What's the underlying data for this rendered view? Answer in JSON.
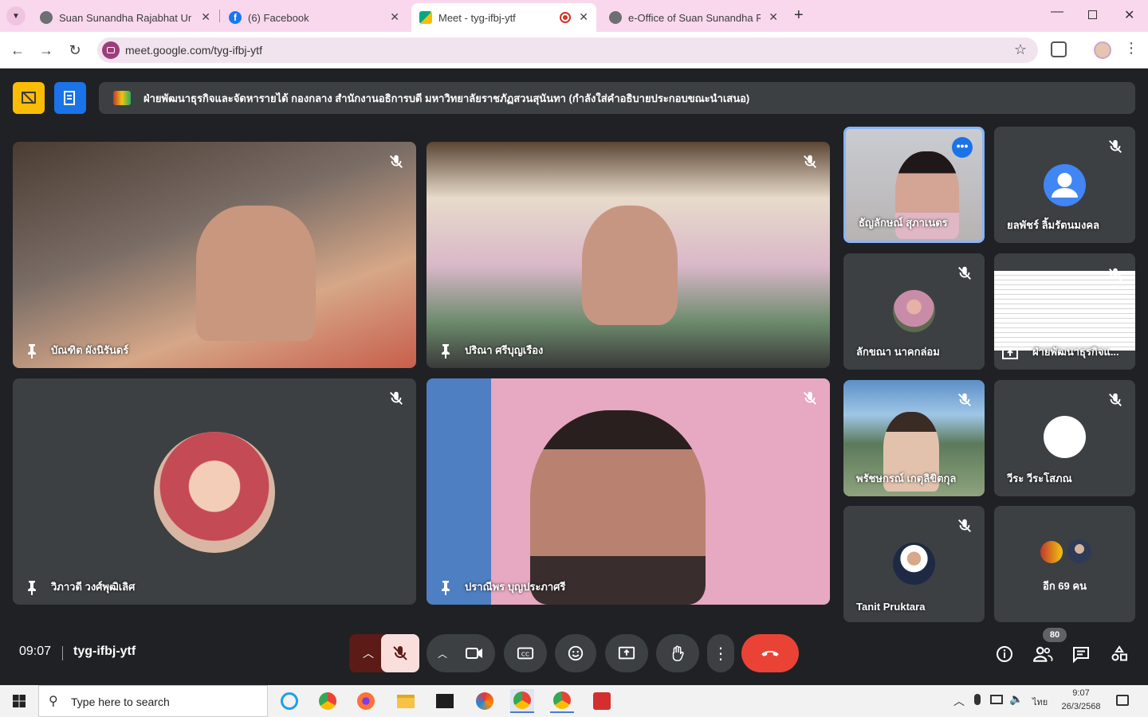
{
  "tabs": [
    {
      "label": "Suan Sunandha Rajabhat Unive",
      "fav": "#6d6f72"
    },
    {
      "label": "(6) Facebook",
      "fav": "#1877f2"
    },
    {
      "label": "Meet - tyg-ifbj-ytf",
      "fav": "#00a884"
    },
    {
      "label": "e-Office of Suan Sunandha Raja",
      "fav": "#6d6f72"
    }
  ],
  "url": "meet.google.com/tyg-ifbj-ytf",
  "caption": "ฝ่ายพัฒนาธุรกิจและจัดหารายได้ กองกลาง สำนักงานอธิการบดี มหาวิทยาลัยราชภัฏสวนสุนันทา (กำลังใส่คำอธิบายประกอบขณะนำเสนอ)",
  "participants": {
    "p1": "บัณฑิต ผังนิรันดร์",
    "p2": "ปริณา ศรีบุญเรือง",
    "p3": "วิภาวดี วงศ์พุฒิเลิศ",
    "p4": "ปราณีพร บุญประภาศรี",
    "s1": "ธัญลักษณ์ สุภาเนตร",
    "s2": "ยลพัชร์ ลิ้มรัตนมงคล",
    "s3": "ลักขณา นาคกล่อม",
    "s4": "ฝ่ายพัฒนาธุรกิจแ...",
    "s5": "พรัชษกรณ์ เกตุลิขิตกุล",
    "s6": "วีระ วีระโสภณ",
    "s7": "Tanit Pruktara",
    "s8": "อีก 69 คน"
  },
  "meeting": {
    "time": "09:07",
    "code": "tyg-ifbj-ytf",
    "people_badge": "80"
  },
  "taskbar": {
    "search": "Type here to search",
    "lang": "ไทย",
    "time": "9:07",
    "date": "26/3/2568"
  },
  "colors": {
    "accent": "#8ab4f8",
    "danger": "#ea4335",
    "tabstrip": "#f9d8ee"
  }
}
